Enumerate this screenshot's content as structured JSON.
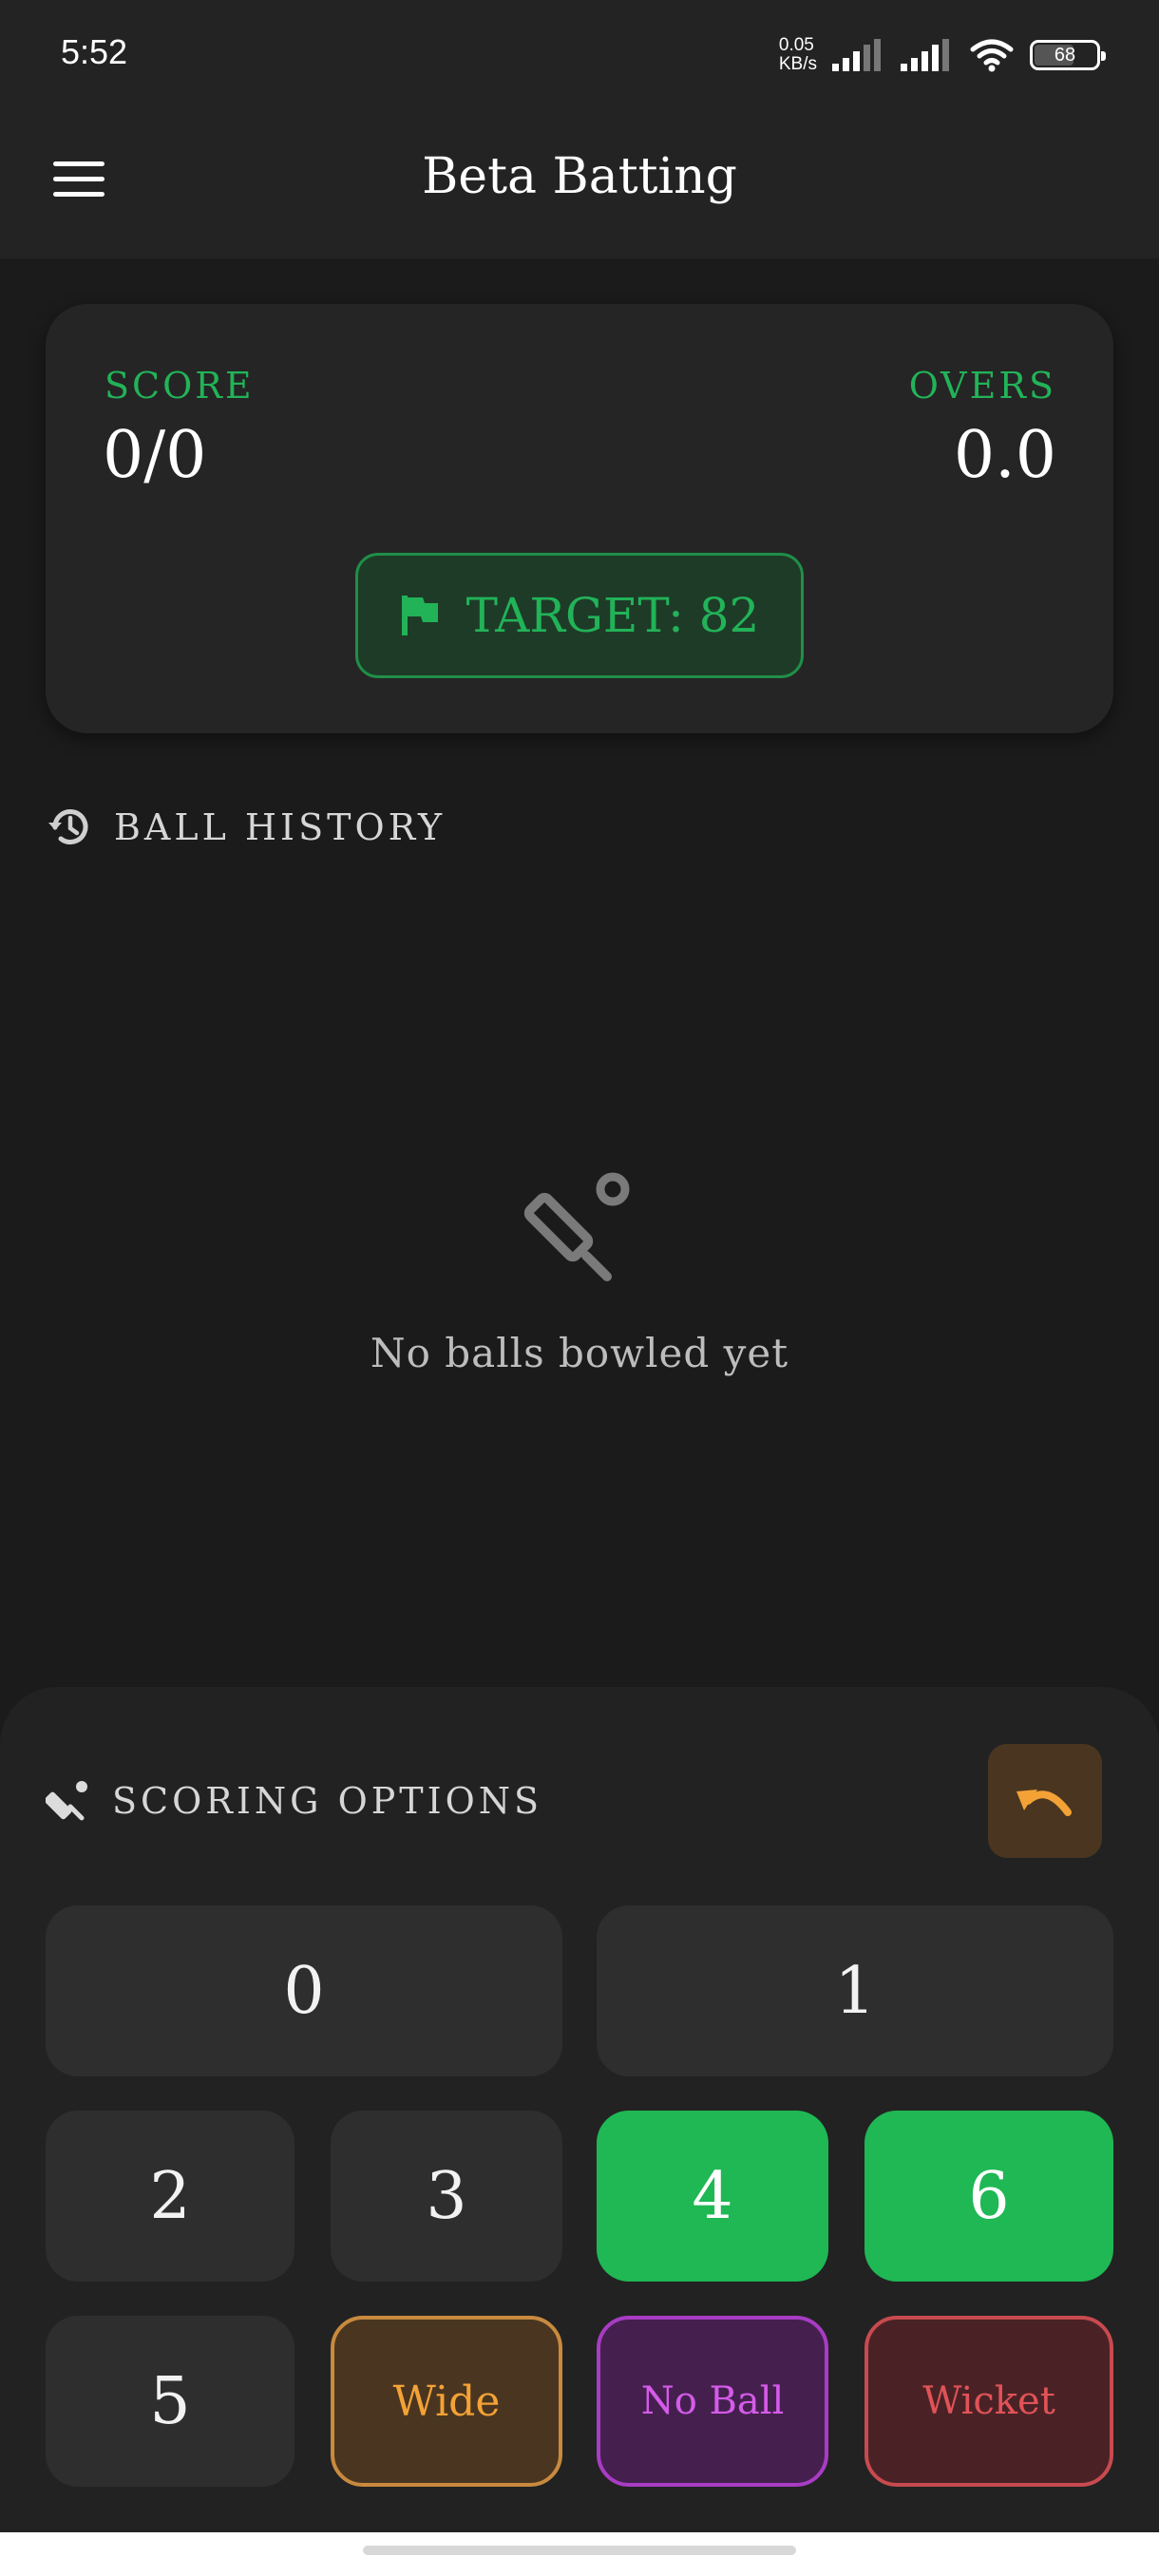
{
  "status_bar": {
    "time": "5:52",
    "net_speed_top": "0.05",
    "net_speed_bottom": "KB/s",
    "battery": "68"
  },
  "app_bar": {
    "title": "Beta Batting",
    "menu_icon": "hamburger-menu-icon"
  },
  "score_card": {
    "score_label": "SCORE",
    "score_value": "0/0",
    "overs_label": "OVERS",
    "overs_value": "0.0",
    "target_label": "TARGET: 82",
    "target_icon": "flag-icon"
  },
  "ball_history": {
    "heading": "BALL HISTORY",
    "heading_icon": "history-icon",
    "empty_icon": "cricket-bat-icon",
    "empty_message": "No balls bowled yet"
  },
  "scoring": {
    "heading": "SCORING OPTIONS",
    "heading_icon": "cricket-icon",
    "undo_icon": "undo-icon",
    "buttons": {
      "zero": "0",
      "one": "1",
      "two": "2",
      "three": "3",
      "four": "4",
      "six": "6",
      "five": "5",
      "wide": "Wide",
      "no_ball": "No Ball",
      "wicket": "Wicket"
    }
  },
  "colors": {
    "accent_green": "#22b358",
    "wide_orange": "#f4a236",
    "no_ball_purple": "#d55be9",
    "wicket_red": "#e05357"
  }
}
